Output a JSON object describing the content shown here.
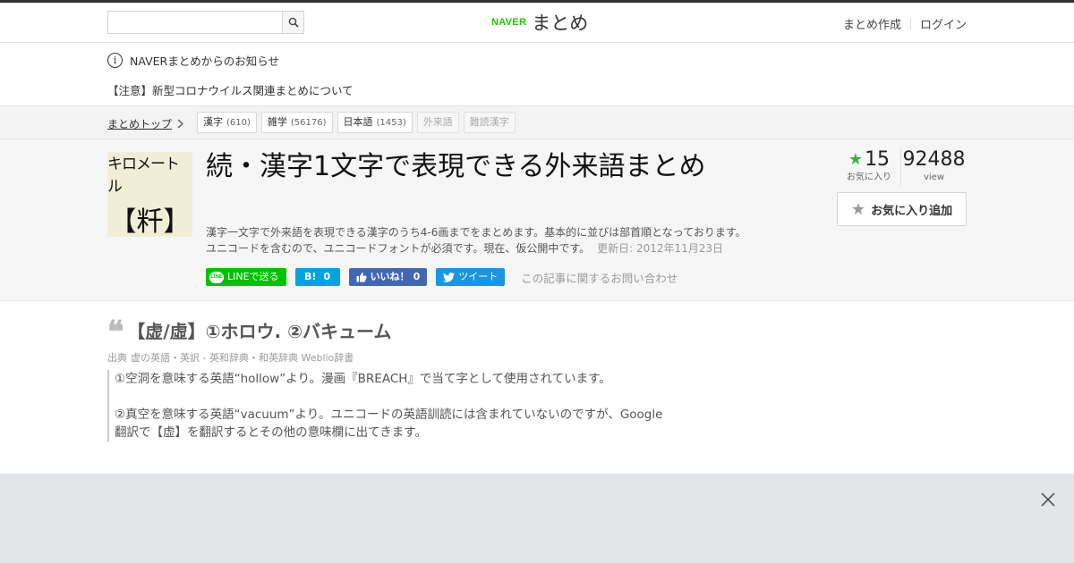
{
  "header": {
    "search_placeholder": "",
    "logo_naver": "NAVER",
    "logo_matome": "まとめ",
    "links": [
      "まとめ作成",
      "ログイン"
    ]
  },
  "notice": {
    "title": "NAVERまとめからのお知らせ",
    "item": "【注意】新型コロナウイルス関連まとめについて"
  },
  "breadcrumb": {
    "home": "まとめトップ",
    "tags": [
      {
        "label": "漢字",
        "count": "(610)"
      },
      {
        "label": "雑学",
        "count": "(56176)"
      },
      {
        "label": "日本語",
        "count": "(1453)"
      },
      {
        "label": "外来語",
        "count": ""
      },
      {
        "label": "難読漢字",
        "count": ""
      }
    ]
  },
  "article": {
    "thumb_top": "キロメートル",
    "thumb_bottom": "【粁】",
    "title": "続・漢字1文字で表現できる外来語まとめ",
    "desc_line1": "漢字一文字で外来語を表現できる漢字のうち4-6画までをまとめます。基本的に並びは部首順となっております。",
    "desc_line2": "ユニコードを含むので、ユニコードフォントが必須です。現在、仮公開中です。",
    "updated": "更新日: 2012年11月23日",
    "share": {
      "line": "LINEで送る",
      "line_badge": "LINE",
      "hatena_icon": "B!",
      "hatena_count": "0",
      "fb_label": "いいね！",
      "fb_count": "0",
      "tweet": "ツイート"
    },
    "inquiry": "この記事に関するお問い合わせ",
    "stats": {
      "fav_count": "15",
      "fav_label": "お気に入り",
      "view_count": "92488",
      "view_label": "view"
    },
    "fav_button": "お気に入り追加"
  },
  "item": {
    "heading": "【虚/虛】①ホロウ. ②バキューム",
    "source_label": "出典",
    "source": "虚の英語・英訳 - 英和辞典・和英辞典 Weblio辞書",
    "para1": "①空洞を意味する英語“hollow”より。漫画『BREACH』で当て字として使用されています。",
    "para2_line1": "②真空を意味する英語“vacuum”より。ユニコードの英語訓読には含まれていないのですが、Google",
    "para2_line2": "翻訳で【虚】を翻訳するとその他の意味欄に出てきます。"
  },
  "colors": {
    "naver_green": "#1ec800",
    "line_green": "#00c300",
    "hatena_blue": "#00a4de",
    "facebook_blue": "#4267b2",
    "twitter_blue": "#1b95e0",
    "star_green": "#3cb43c"
  },
  "icons": [
    "search-icon",
    "info-icon",
    "chevron-right-icon",
    "star-icon",
    "quote-icon",
    "close-icon",
    "like-icon",
    "twitter-bird-icon"
  ]
}
